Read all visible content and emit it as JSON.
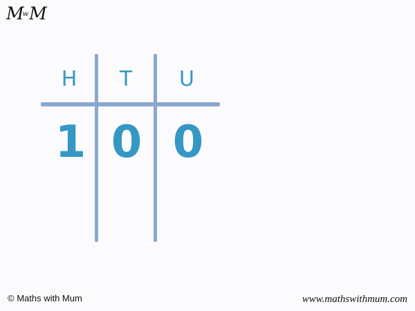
{
  "logo": {
    "left": "M",
    "middle": "w",
    "right": "M"
  },
  "place_value_chart": {
    "headers": [
      "H",
      "T",
      "U"
    ],
    "digits": [
      "1",
      "0",
      "0"
    ],
    "accent_color": "#3597c4",
    "line_color": "#8aa7cf"
  },
  "footer": {
    "copyright": "© Maths with Mum",
    "website": "www.mathswithmum.com"
  }
}
